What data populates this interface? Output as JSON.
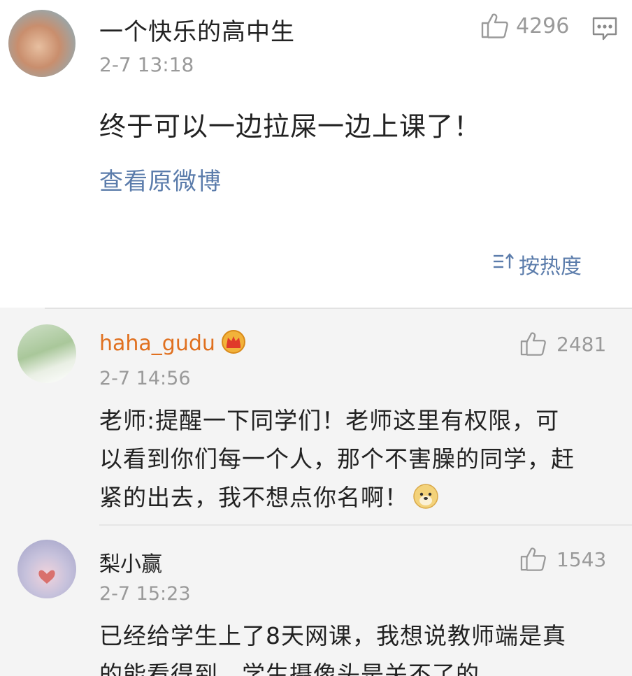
{
  "post": {
    "author": "一个快乐的高中生",
    "time": "2-7 13:18",
    "likes": "4296",
    "text": "终于可以一边拉屎一边上课了！",
    "view_original": "查看原微博",
    "sort_label": "按热度"
  },
  "comments": [
    {
      "name": "haha_gudu",
      "name_color": "#e0701f",
      "badge_icon": "crown-icon",
      "time": "2-7 14:56",
      "likes": "2481",
      "lines": [
        "老师:提醒一下同学们！老师这里有权限，可",
        "以看到你们每一个人，那个不害臊的同学，赶",
        "紧的出去，我不想点你名啊！"
      ],
      "trailing_emoji": "doge-emoji"
    },
    {
      "name": "梨小赢",
      "name_color": "#222222",
      "time": "2-7 15:23",
      "likes": "1543",
      "lines": [
        "已经给学生上了8天网课，我想说教师端是真",
        "的能看得到，学生摄像头是关不了的"
      ]
    }
  ],
  "colors": {
    "link": "#5b7cab",
    "muted": "#9a9a9a",
    "comment_bg": "#f4f4f4"
  }
}
